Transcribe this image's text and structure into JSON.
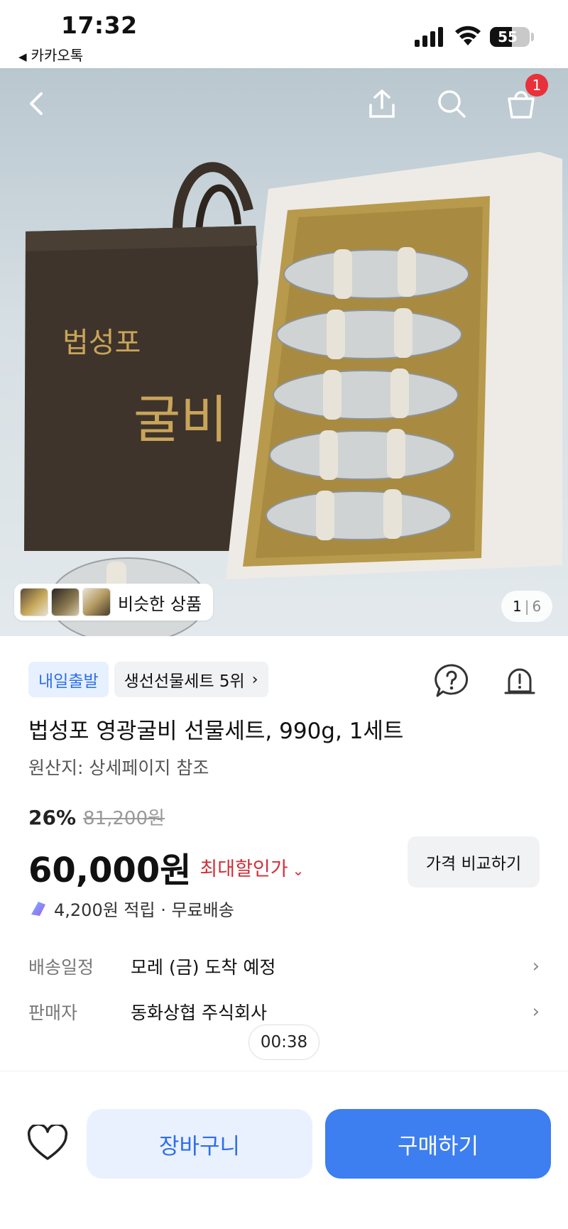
{
  "status_bar": {
    "time": "17:32",
    "back_app": "카카오톡",
    "battery_percent": 55,
    "battery_label": "55"
  },
  "header": {
    "icons": [
      "back-icon",
      "share-icon",
      "search-icon",
      "cart-icon"
    ],
    "cart_count": "1"
  },
  "hero": {
    "bag_text_top": "법성포",
    "bag_text_brand": "굴비",
    "similar_label": "비슷한 상품",
    "page_current": "1",
    "page_total": "6"
  },
  "product": {
    "badge_delivery": "내일출발",
    "badge_rank": "생선선물세트 5위",
    "title": "법성포 영광굴비 선물세트, 990g, 1세트",
    "origin": "원산지: 상세페이지 참조",
    "discount_percent": "26%",
    "original_price": "81,200원",
    "price": "60,000원",
    "max_discount_label": "최대할인가",
    "compare_button": "가격 비교하기",
    "points_text": "4,200원 적립 · 무료배송"
  },
  "info_rows": [
    {
      "key": "배송일정",
      "value": "모레 (금) 도착 예정"
    },
    {
      "key": "판매자",
      "value": "동화상협 주식회사"
    }
  ],
  "timer": "00:38",
  "bottom_bar": {
    "cart_button": "장바구니",
    "buy_button": "구매하기"
  },
  "colors": {
    "accent_blue": "#3d7ef0",
    "delivery_badge_text": "#2e6fe8",
    "discount_red": "#d0303a",
    "badge_red": "#e8313a"
  }
}
